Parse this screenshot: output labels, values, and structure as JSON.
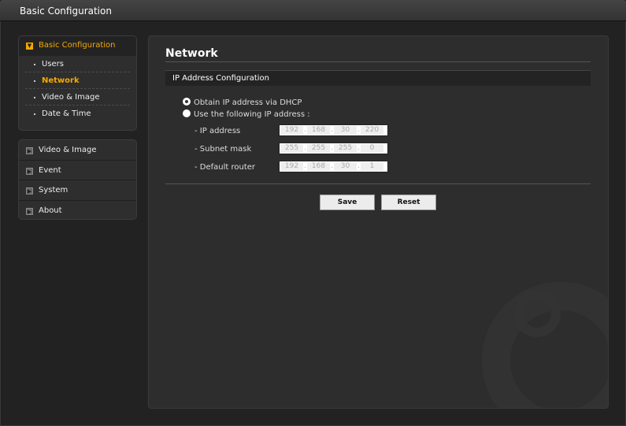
{
  "window": {
    "title": "Basic Configuration"
  },
  "sidebar": {
    "expanded": {
      "label": "Basic Configuration",
      "items": [
        {
          "label": "Users"
        },
        {
          "label": "Network",
          "active": true
        },
        {
          "label": "Video & Image"
        },
        {
          "label": "Date & Time"
        }
      ]
    },
    "sections": [
      {
        "label": "Video & Image"
      },
      {
        "label": "Event"
      },
      {
        "label": "System"
      },
      {
        "label": "About"
      }
    ]
  },
  "main": {
    "title": "Network",
    "section": "IP Address Configuration",
    "radio_dhcp": "Obtain IP address via DHCP",
    "radio_static": "Use the following IP address :",
    "selected": "dhcp",
    "fields": [
      {
        "label": "- IP address",
        "octets": [
          "192",
          "168",
          "30",
          "220"
        ]
      },
      {
        "label": "- Subnet mask",
        "octets": [
          "255",
          "255",
          "255",
          "0"
        ]
      },
      {
        "label": "- Default router",
        "octets": [
          "192",
          "168",
          "30",
          "1"
        ]
      }
    ],
    "save": "Save",
    "reset": "Reset",
    "separator": "."
  }
}
